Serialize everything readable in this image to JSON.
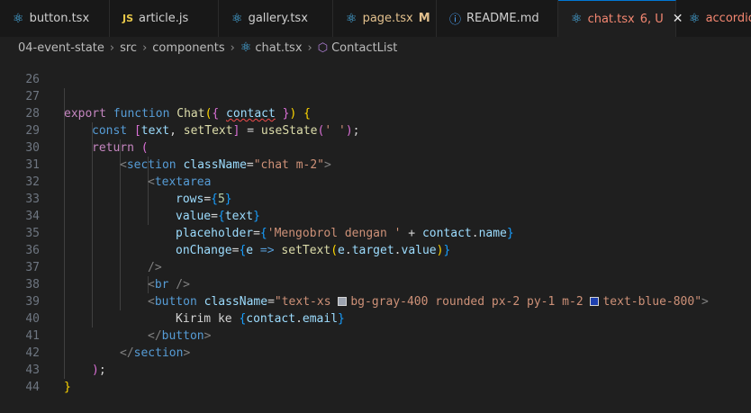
{
  "tabs": [
    {
      "icon": "react-icon",
      "label": "button.tsx",
      "badge": ""
    },
    {
      "icon": "js-icon",
      "label": "article.js",
      "badge": ""
    },
    {
      "icon": "react-icon",
      "label": "gallery.tsx",
      "badge": ""
    },
    {
      "icon": "react-icon",
      "label": "page.tsx",
      "badge": "M"
    },
    {
      "icon": "info-icon",
      "label": "README.md",
      "badge": ""
    },
    {
      "icon": "react-icon",
      "label": "chat.tsx",
      "badge": "6, U"
    },
    {
      "icon": "react-icon",
      "label": "accordion",
      "badge": ""
    }
  ],
  "breadcrumb": [
    "04-event-state",
    "src",
    "components",
    "chat.tsx",
    "ContactList"
  ],
  "swatches": {
    "gray400": "#9ca3af",
    "blue800": "#1e40af"
  },
  "lines": {
    "l26": {
      "n": "26"
    },
    "l27": {
      "n": "27",
      "t1": "export",
      "t2": "function",
      "t3": "Chat",
      "t4": "(",
      "t5": "{",
      "t6": "contact",
      "t7": "}",
      "t8": ")",
      "t9": "{"
    },
    "l28": {
      "n": "28",
      "t1": "const",
      "t2": "[",
      "t3": "text",
      "t4": ",",
      "t5": "setText",
      "t6": "]",
      "t7": "=",
      "t8": "useState",
      "t9": "(",
      "t10": "' '",
      "t11": ")",
      "t12": ";"
    },
    "l29": {
      "n": "29",
      "t1": "return",
      "t2": "("
    },
    "l30": {
      "n": "30",
      "t1": "<",
      "t2": "section",
      "t3": "className",
      "t4": "=",
      "t5": "\"chat m-2\"",
      "t6": ">"
    },
    "l31": {
      "n": "31",
      "t1": "<",
      "t2": "textarea"
    },
    "l32": {
      "n": "32",
      "t1": "rows",
      "t2": "=",
      "t3": "{",
      "t4": "5",
      "t5": "}"
    },
    "l33": {
      "n": "33",
      "t1": "value",
      "t2": "=",
      "t3": "{",
      "t4": "text",
      "t5": "}"
    },
    "l34": {
      "n": "34",
      "t1": "placeholder",
      "t2": "=",
      "t3": "{",
      "t4": "'Mengobrol dengan '",
      "t5": " + ",
      "t6": "contact",
      "t7": ".",
      "t8": "name",
      "t9": "}"
    },
    "l35": {
      "n": "35",
      "t1": "onChange",
      "t2": "=",
      "t3": "{",
      "t4": "e",
      "t5": " => ",
      "t6": "setText",
      "t7": "(",
      "t8": "e",
      "t9": ".",
      "t10": "target",
      "t11": ".",
      "t12": "value",
      "t13": ")",
      "t14": "}"
    },
    "l36": {
      "n": "36",
      "t1": "/>"
    },
    "l37": {
      "n": "37",
      "t1": "<",
      "t2": "br",
      "t3": " />"
    },
    "l38": {
      "n": "38",
      "t1": "<",
      "t2": "button",
      "t3": "className",
      "t4": "=",
      "t5": "\"text-xs ",
      "t6": "bg-gray-400 rounded px-2 py-1 m-2 ",
      "t7": "text-blue-800\"",
      "t8": ">"
    },
    "l39": {
      "n": "39",
      "t1": "Kirim ke ",
      "t2": "{",
      "t3": "contact",
      "t4": ".",
      "t5": "email",
      "t6": "}"
    },
    "l40": {
      "n": "40",
      "t1": "</",
      "t2": "button",
      "t3": ">"
    },
    "l41": {
      "n": "41",
      "t1": "</",
      "t2": "section",
      "t3": ">"
    },
    "l42": {
      "n": "42",
      "t1": ")",
      "t2": ";"
    },
    "l43": {
      "n": "43",
      "t1": "}"
    },
    "l44": {
      "n": "44"
    }
  }
}
